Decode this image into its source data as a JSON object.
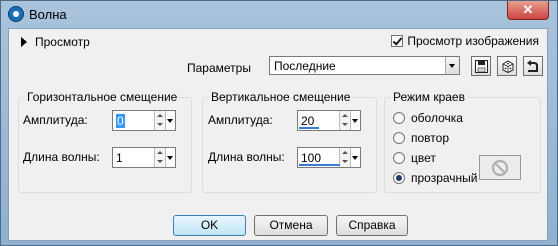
{
  "window": {
    "title": "Волна",
    "close_label": "✕"
  },
  "preview": {
    "toggle_label": "Просмотр",
    "show_preview_label": "Просмотр изображения",
    "show_preview_checked": true
  },
  "parameters": {
    "label": "Параметры",
    "preset_value": "Последние"
  },
  "horizontal": {
    "title": "Горизонтальное смещение",
    "amplitude_label": "Амплитуда:",
    "amplitude_value": "0",
    "wavelength_label": "Длина волны:",
    "wavelength_value": "1"
  },
  "vertical": {
    "title": "Вертикальное смещение",
    "amplitude_label": "Амплитуда:",
    "amplitude_value": "20",
    "wavelength_label": "Длина волны:",
    "wavelength_value": "100"
  },
  "edge_mode": {
    "title": "Режим краев",
    "options": [
      "оболочка",
      "повтор",
      "цвет",
      "прозрачный"
    ],
    "selected": "прозрачный"
  },
  "buttons": {
    "ok": "OK",
    "cancel": "Отмена",
    "help": "Справка"
  },
  "colors": {
    "title_bar": "#a9c3dc",
    "accent": "#3a7bd5"
  }
}
